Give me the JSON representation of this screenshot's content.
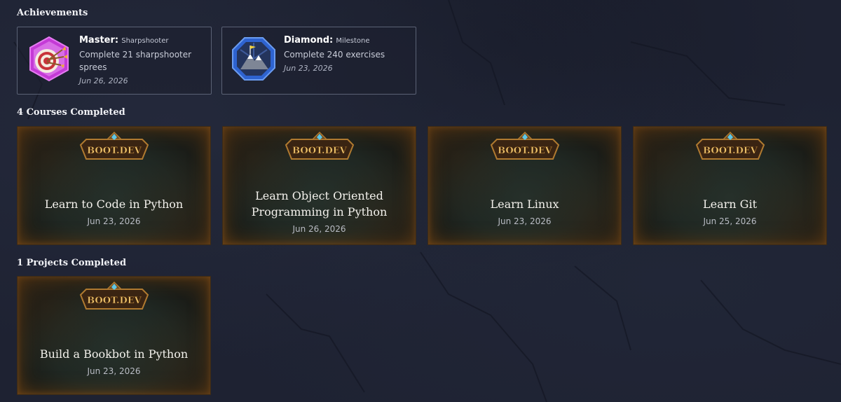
{
  "achievements_section": {
    "title": "Achievements",
    "items": [
      {
        "tier": "Master:",
        "category": "Sharpshooter",
        "description": "Complete 21 sharpshooter sprees",
        "date": "Jun 26, 2026",
        "icon": "target-icon",
        "badge_color": "#c43ad6"
      },
      {
        "tier": "Diamond:",
        "category": "Milestone",
        "description": "Complete 240 exercises",
        "date": "Jun 23, 2026",
        "icon": "mountain-flag-icon",
        "badge_color": "#3a6fd8"
      }
    ]
  },
  "courses_section": {
    "title": "4 Courses Completed",
    "items": [
      {
        "name": "Learn to Code in Python",
        "date": "Jun 23, 2026"
      },
      {
        "name": "Learn Object Oriented Programming in Python",
        "date": "Jun 26, 2026"
      },
      {
        "name": "Learn Linux",
        "date": "Jun 23, 2026"
      },
      {
        "name": "Learn Git",
        "date": "Jun 25, 2026"
      }
    ]
  },
  "projects_section": {
    "title": "1 Projects Completed",
    "items": [
      {
        "name": "Build a Bookbot in Python",
        "date": "Jun 23, 2026"
      }
    ]
  },
  "logo_text": "BOOT.DEV"
}
